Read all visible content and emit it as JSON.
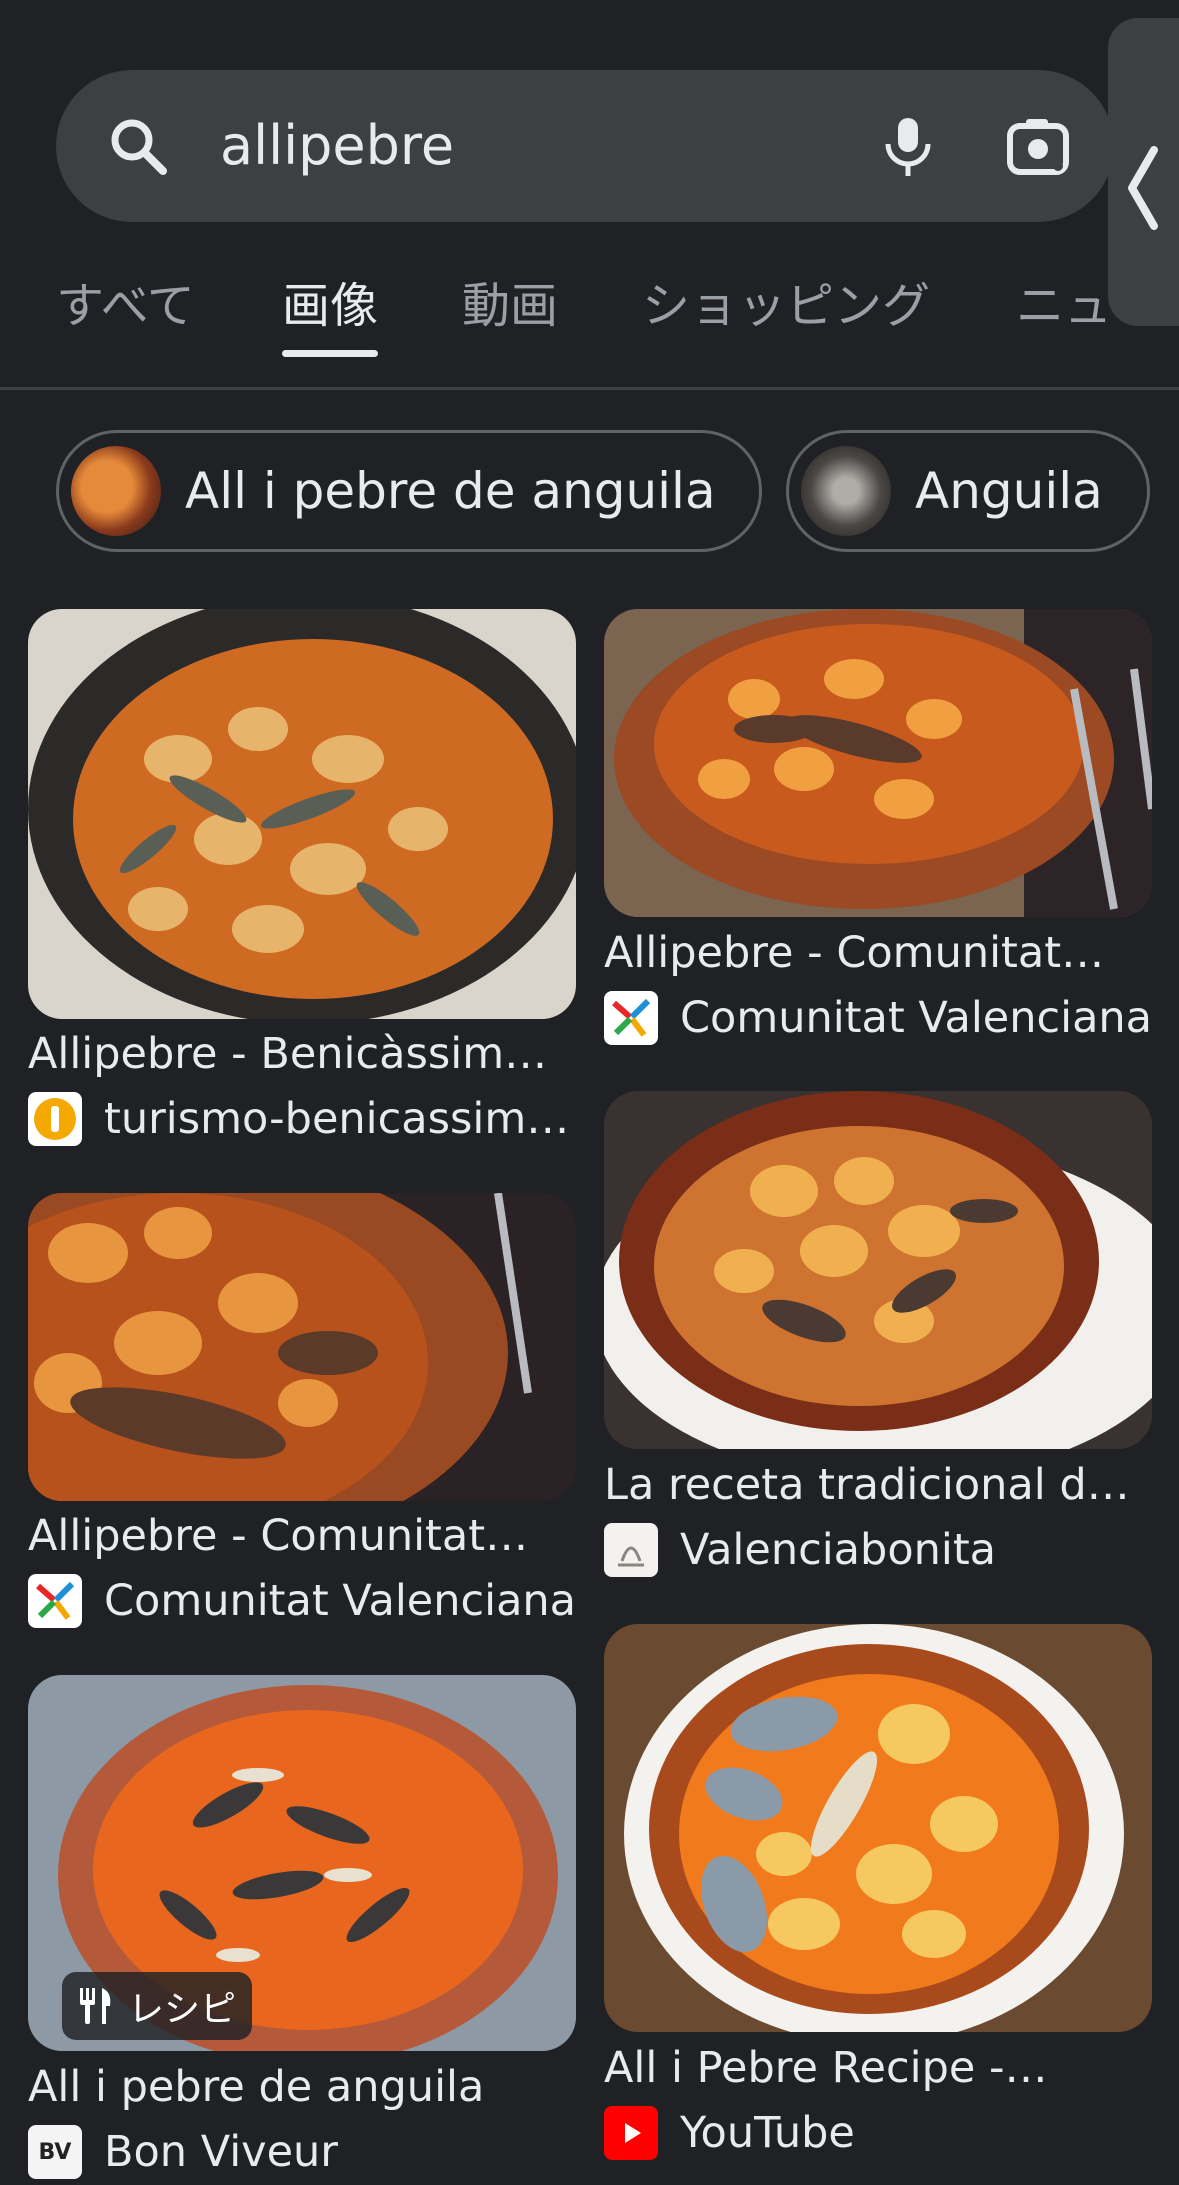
{
  "search": {
    "query": "allipebre"
  },
  "tabs": [
    {
      "label": "すべて"
    },
    {
      "label": "画像",
      "active": true
    },
    {
      "label": "動画"
    },
    {
      "label": "ショッピング"
    },
    {
      "label": "ニュ"
    }
  ],
  "chips": [
    {
      "label": "All i pebre de anguila"
    },
    {
      "label": "Anguila"
    }
  ],
  "results": [
    {
      "title": "Allipebre - Benicàssim…",
      "source": "turismo-benicassim…",
      "icon": "turismo-benicassim-favicon"
    },
    {
      "title": "Allipebre - Comunitat…",
      "source": "Comunitat Valenciana",
      "icon": "comunitat-valenciana-favicon"
    },
    {
      "title": "Allipebre - Comunitat…",
      "source": "Comunitat Valenciana",
      "icon": "comunitat-valenciana-favicon"
    },
    {
      "title": "La receta tradicional d…",
      "source": "Valenciabonita",
      "icon": "valenciabonita-favicon"
    },
    {
      "title": "All i pebre de anguila",
      "source": "Bon Viveur",
      "icon": "bon-viveur-favicon",
      "badge": "レシピ"
    },
    {
      "title": "All i Pebre Recipe -…",
      "source": "YouTube",
      "icon": "youtube-favicon"
    }
  ],
  "favicons": {
    "bon_viveur_text": "BV"
  },
  "colors": {
    "background": "#202124",
    "search_bar": "#3c4043",
    "text": "#e8eaed",
    "muted": "#9aa0a6",
    "youtube": "#ff0000"
  }
}
